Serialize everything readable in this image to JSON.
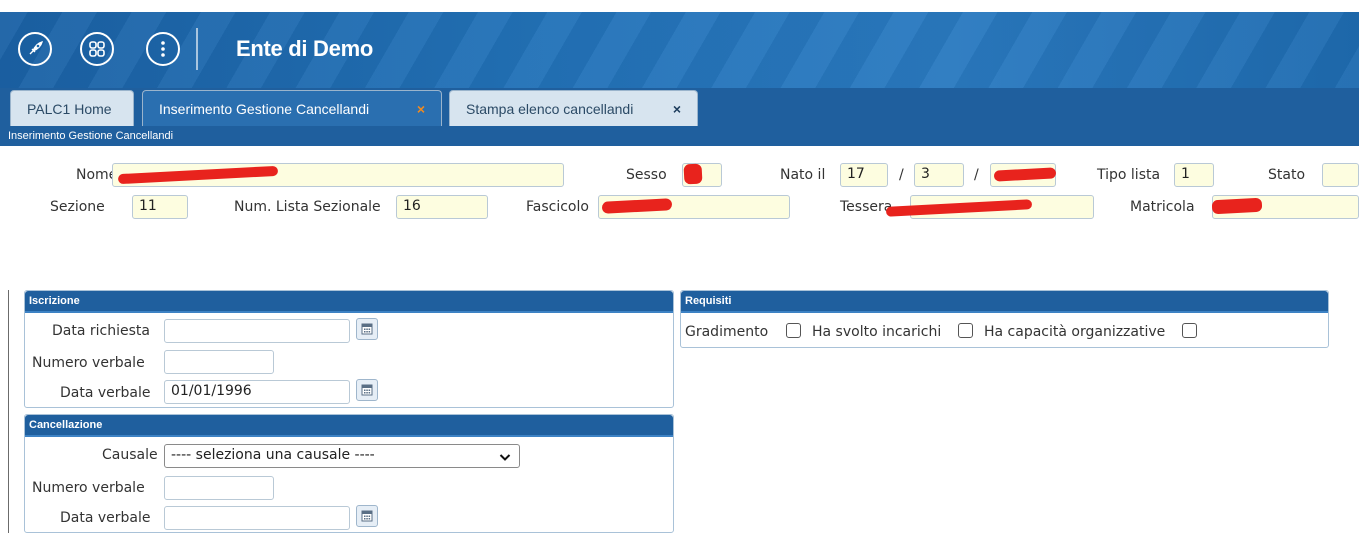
{
  "header": {
    "title": "Ente di Demo",
    "icons": [
      "rocket-icon",
      "apps-grid-icon",
      "more-vertical-icon"
    ]
  },
  "tabs": [
    {
      "label": "PALC1 Home"
    },
    {
      "label": "Inserimento Gestione Cancellandi",
      "close": "×"
    },
    {
      "label": "Stampa elenco cancellandi",
      "close": "×"
    }
  ],
  "subtitle": "Inserimento Gestione Cancellandi",
  "form": {
    "nome_label": "Nome",
    "sesso_label": "Sesso",
    "nato_il_label": "Nato il",
    "nato_day": "17",
    "nato_month": "3",
    "date_sep": "/",
    "tipo_lista_label": "Tipo lista",
    "tipo_lista_value": "1",
    "stato_label": "Stato",
    "sezione_label": "Sezione",
    "sezione_value": "11",
    "num_lista_label": "Num. Lista Sezionale",
    "num_lista_value": "16",
    "fascicolo_label": "Fascicolo",
    "tessera_label": "Tessera",
    "matricola_label": "Matricola"
  },
  "iscrizione": {
    "title": "Iscrizione",
    "data_richiesta_label": "Data richiesta",
    "data_richiesta_value": "",
    "numero_verbale_label": "Numero verbale",
    "numero_verbale_value": "",
    "data_verbale_label": "Data verbale",
    "data_verbale_value": "01/01/1996"
  },
  "cancellazione": {
    "title": "Cancellazione",
    "causale_label": "Causale",
    "causale_selected": "---- seleziona una causale ----",
    "numero_verbale_label": "Numero verbale",
    "data_verbale_label": "Data verbale"
  },
  "requisiti": {
    "title": "Requisiti",
    "gradimento_label": "Gradimento",
    "ha_svolto_label": "Ha svolto incarichi",
    "ha_capacita_label": "Ha capacità organizzative"
  },
  "colors": {
    "header_blue": "#1e6bb0",
    "tab_active": "#2a6fb0",
    "close_orange": "#f28a1e",
    "field_yellow": "#fdfde0",
    "redaction": "#e8231d"
  }
}
